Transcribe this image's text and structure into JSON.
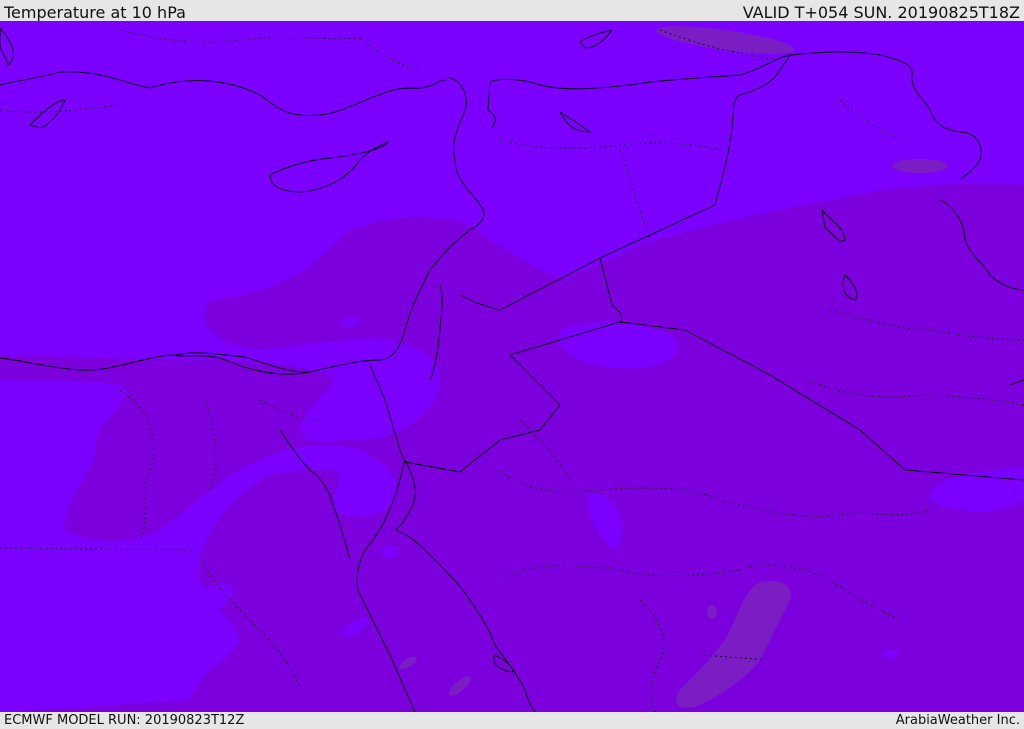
{
  "header": {
    "title": "Temperature at 10 hPa",
    "valid": "VALID T+054 SUN. 20190825T18Z"
  },
  "footer": {
    "model_run": "ECMWF MODEL RUN: 20190823T12Z",
    "credit": "ArabiaWeather Inc."
  },
  "map": {
    "colors": {
      "warm_band": "#7b00ff",
      "cool_band": "#7b00dd",
      "coldest_band": "#7a1ec4",
      "border_line": "#000000"
    }
  }
}
